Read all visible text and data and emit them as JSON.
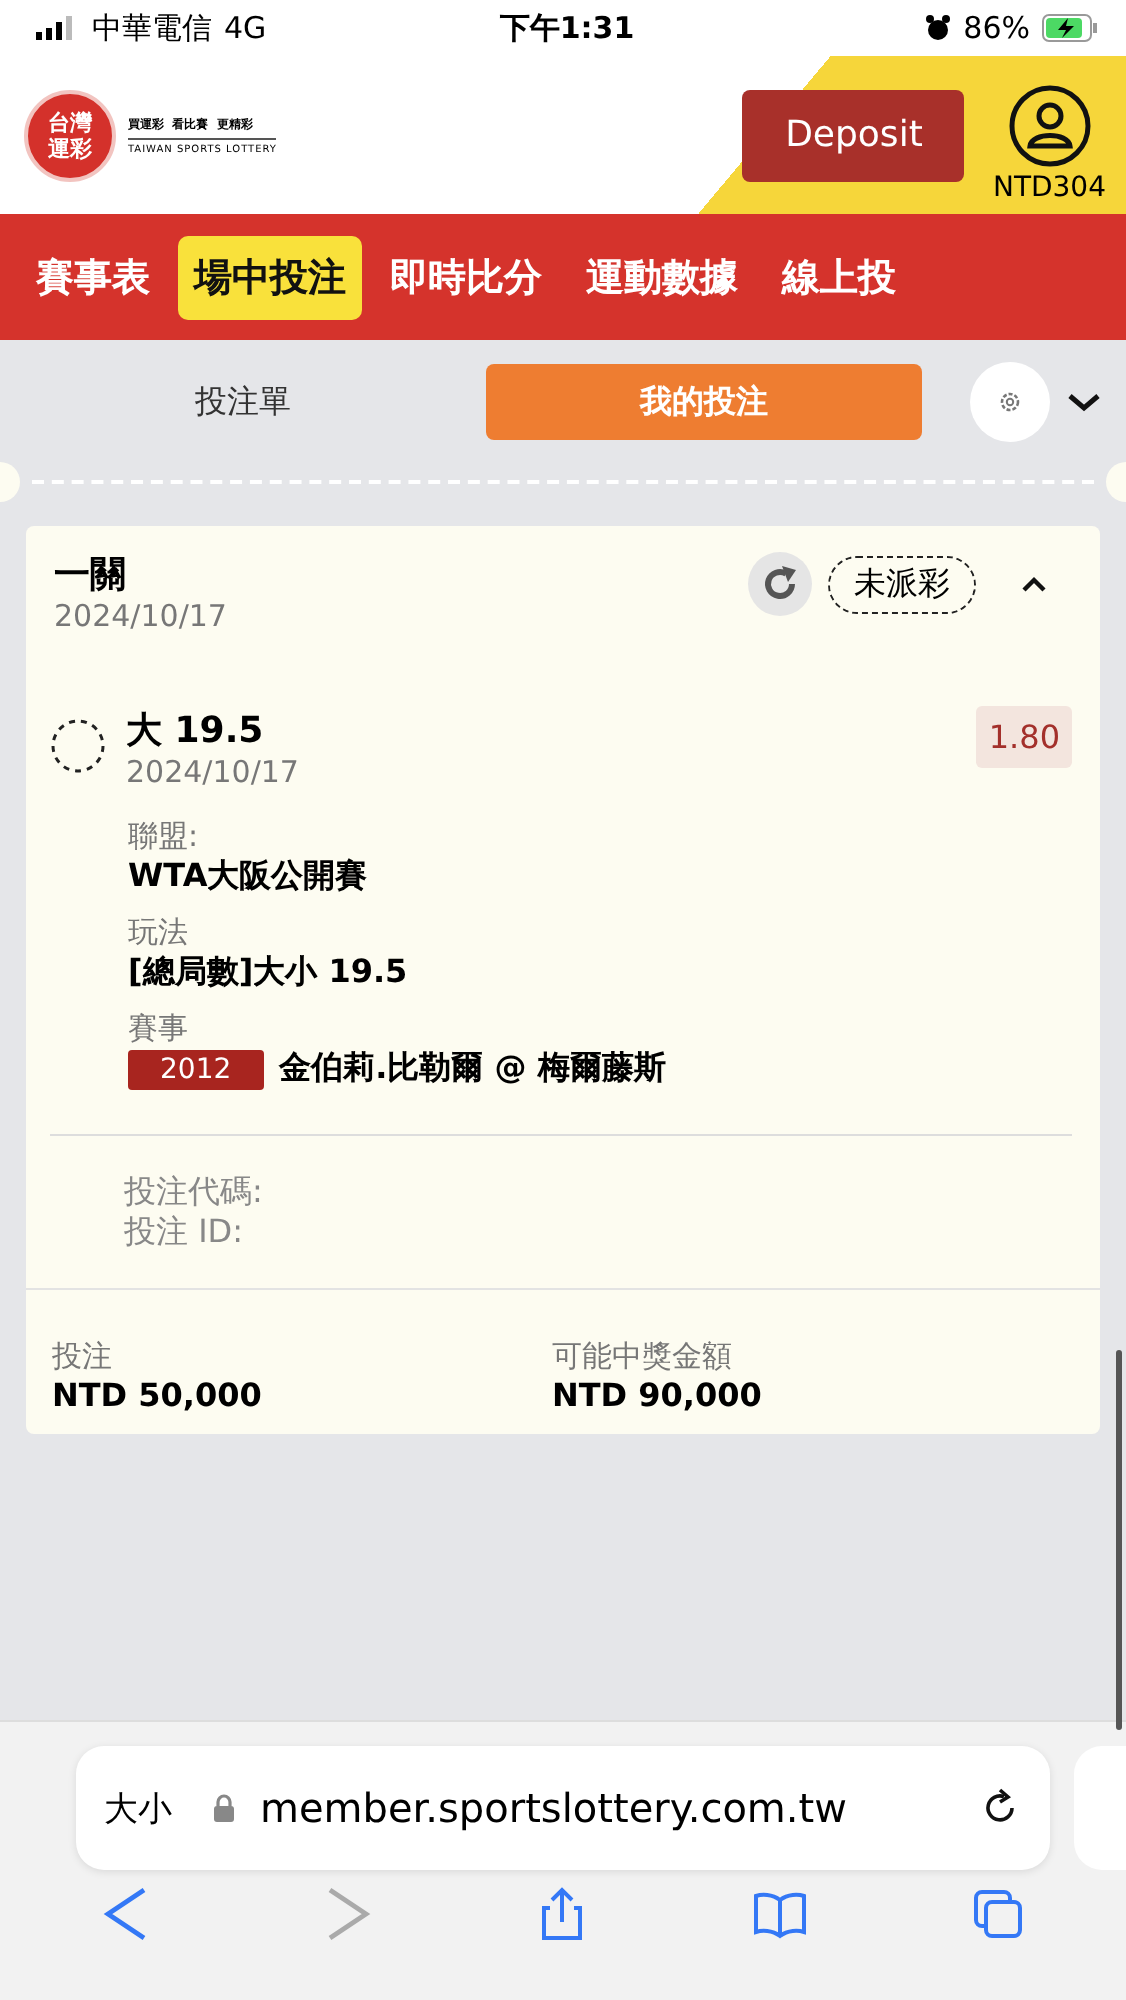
{
  "status_bar": {
    "carrier": "中華電信",
    "network": "4G",
    "time": "下午1:31",
    "battery": "86%"
  },
  "header": {
    "logo_text": "台灣運彩",
    "slogan": "買運彩  看比賽  更精彩",
    "logo_subtitle": "TAIWAN SPORTS LOTTERY",
    "deposit_button": "Deposit",
    "balance": "NTD304"
  },
  "nav_tabs": [
    {
      "label": "賽事表",
      "selected": false
    },
    {
      "label": "場中投注",
      "selected": true
    },
    {
      "label": "即時比分",
      "selected": false
    },
    {
      "label": "運動數據",
      "selected": false
    },
    {
      "label": "線上投",
      "selected": false
    }
  ],
  "bet_tabs": [
    {
      "label": "投注單",
      "selected": false
    },
    {
      "label": "我的投注",
      "selected": true
    }
  ],
  "bet": {
    "title": "一關",
    "date": "2024/10/17",
    "status": "未派彩",
    "expanded": true,
    "selection": {
      "name": "大 19.5",
      "date": "2024/10/17",
      "odds": "1.80"
    },
    "details": [
      {
        "label": "聯盟:",
        "value": "WTA大阪公開賽"
      },
      {
        "label": "玩法",
        "value": "[總局數]大小 19.5"
      },
      {
        "label": "賽事",
        "badge": "2012",
        "value": "金伯莉.比勒爾 @ 梅爾藤斯"
      }
    ],
    "codes": [
      "投注代碼:",
      "投注 ID:"
    ],
    "stake_label": "投注",
    "stake": "NTD 50,000",
    "payout_label": "可能中獎金額",
    "payout": "NTD 90,000"
  },
  "browser": {
    "text_size": "大小",
    "url": "member.sportslottery.com.tw"
  }
}
